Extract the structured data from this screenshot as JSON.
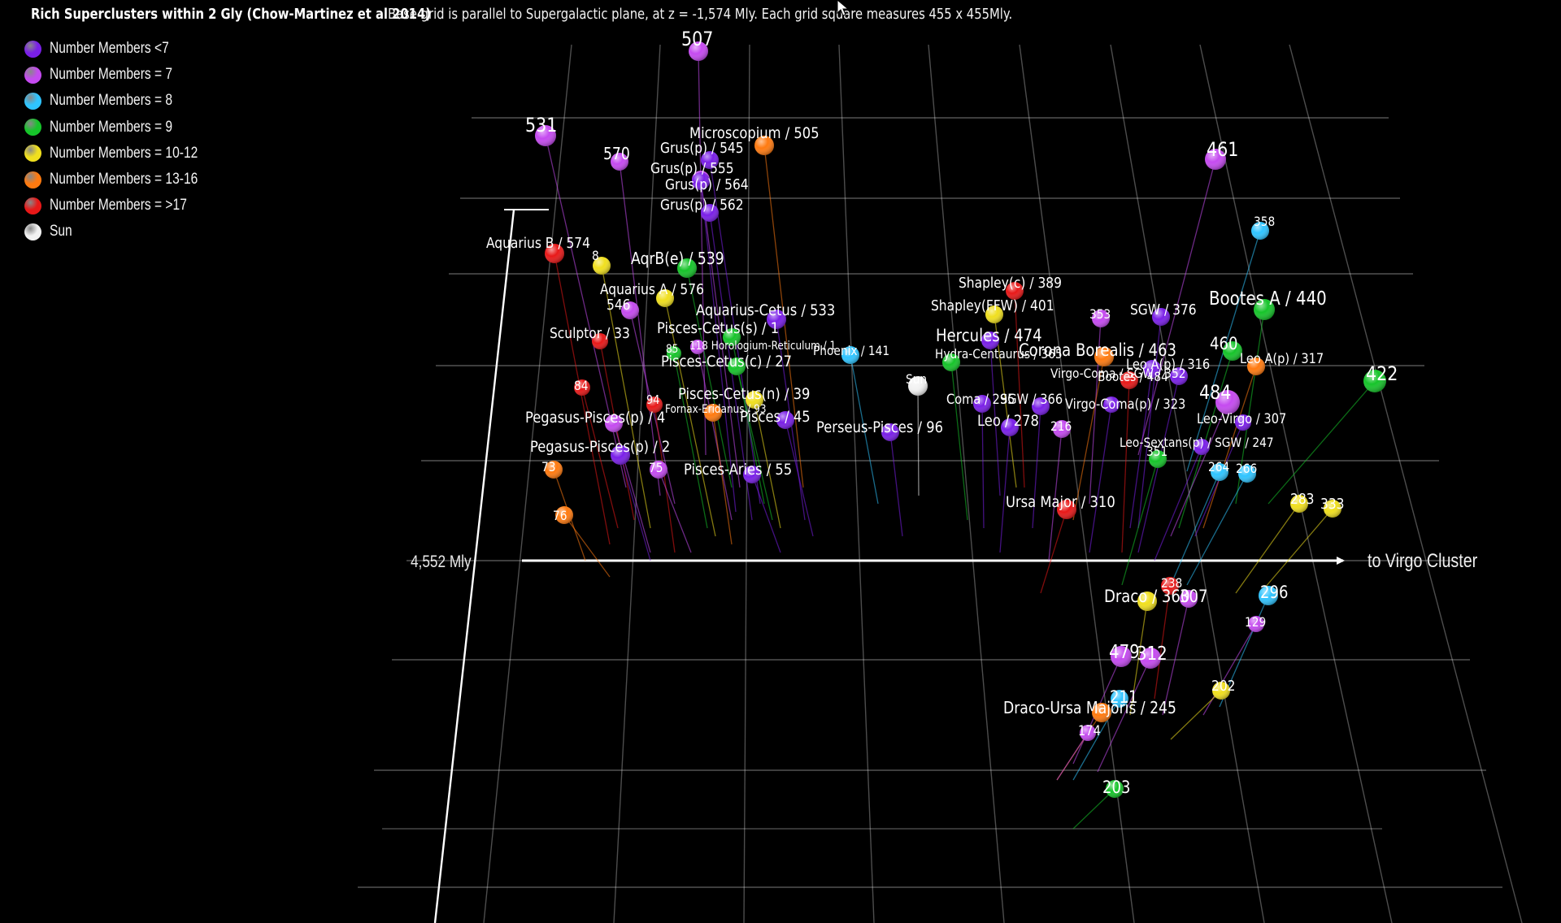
{
  "header": {
    "title": "Rich Superclusters within 2 Gly (Chow-Martinez et al 2014)",
    "description": "Base grid is parallel to Supergalactic plane, at z = -1,574 Mly. Each grid square measures 455 x 455Mly."
  },
  "legend": [
    {
      "label": "Number Members <7",
      "color": "#7a1fe8"
    },
    {
      "label": "Number Members = 7",
      "color": "#c54af0"
    },
    {
      "label": "Number Members = 8",
      "color": "#2fc4ff"
    },
    {
      "label": "Number Members = 9",
      "color": "#16c42a"
    },
    {
      "label": "Number Members = 10-12",
      "color": "#f0df1e"
    },
    {
      "label": "Number Members = 13-16",
      "color": "#ff7a10"
    },
    {
      "label": "Number Members = >17",
      "color": "#e81818"
    },
    {
      "label": "Sun",
      "color": "#f2f2f2"
    }
  ],
  "axes": {
    "distance_label": "4,552 Mly",
    "direction_label": "to Virgo Cluster"
  },
  "clusters": [
    {
      "label": "507",
      "color": "#c54af0"
    },
    {
      "label": "531",
      "color": "#c54af0"
    },
    {
      "label": "570",
      "color": "#c54af0"
    },
    {
      "label": "Microscopium / 505",
      "color": "#ff7a10"
    },
    {
      "label": "Grus(p) / 545",
      "color": "#7a1fe8"
    },
    {
      "label": "Grus(p) / 555",
      "color": "#c54af0"
    },
    {
      "label": "Grus(p) / 564",
      "color": "#7a1fe8"
    },
    {
      "label": "Grus(p) / 562",
      "color": "#7a1fe8"
    },
    {
      "label": "Aquarius B / 574",
      "color": "#e81818"
    },
    {
      "label": "8",
      "color": "#f0df1e"
    },
    {
      "label": "AqrB(e) / 539",
      "color": "#16c42a"
    },
    {
      "label": "Aquarius A / 576",
      "color": "#f0df1e"
    },
    {
      "label": "546",
      "color": "#c54af0"
    },
    {
      "label": "Aquarius-Cetus / 533",
      "color": "#7a1fe8"
    },
    {
      "label": "Sculptor / 33",
      "color": "#e81818"
    },
    {
      "label": "Pisces-Cetus(s) / 1",
      "color": "#16c42a"
    },
    {
      "label": "118 Horologium-Reticulum / 1",
      "color": "#c54af0"
    },
    {
      "label": "85",
      "color": "#16c42a"
    },
    {
      "label": "Phoenix / 141",
      "color": "#2fc4ff"
    },
    {
      "label": "Pisces-Cetus(c) / 27",
      "color": "#16c42a"
    },
    {
      "label": "Hydra-Centaurus / 365",
      "color": "#16c42a"
    },
    {
      "label": "84",
      "color": "#e81818"
    },
    {
      "label": "94",
      "color": "#e81818"
    },
    {
      "label": "Fornax-Eridanus / 93",
      "color": "#ff7a10"
    },
    {
      "label": "Pisces-Cetus(n) / 39",
      "color": "#f0df1e"
    },
    {
      "label": "Pisces / 45",
      "color": "#7a1fe8"
    },
    {
      "label": "Pegasus-Pisces(p) / 4",
      "color": "#c54af0"
    },
    {
      "label": "Pegasus-Pisces(p) / 2",
      "color": "#7a1fe8"
    },
    {
      "label": "73",
      "color": "#ff7a10"
    },
    {
      "label": "75",
      "color": "#c54af0"
    },
    {
      "label": "Pisces-Aries / 55",
      "color": "#7a1fe8"
    },
    {
      "label": "76",
      "color": "#ff7a10"
    },
    {
      "label": "Perseus-Pisces / 96",
      "color": "#7a1fe8"
    },
    {
      "label": "Sun",
      "color": "#f2f2f2"
    },
    {
      "label": "Shapley(c) / 389",
      "color": "#e81818"
    },
    {
      "label": "Shapley(FFW) / 401",
      "color": "#f0df1e"
    },
    {
      "label": "353",
      "color": "#c54af0"
    },
    {
      "label": "SGW / 376",
      "color": "#7a1fe8"
    },
    {
      "label": "Bootes A / 440",
      "color": "#16c42a"
    },
    {
      "label": "Hercules / 474",
      "color": "#7a1fe8"
    },
    {
      "label": "Corona Borealis / 463",
      "color": "#ff7a10"
    },
    {
      "label": "Leo A(p) / 316",
      "color": "#7a1fe8"
    },
    {
      "label": "460",
      "color": "#16c42a"
    },
    {
      "label": "Leo A(p) / 317",
      "color": "#ff7a10"
    },
    {
      "label": "Virgo-Coma / SGW / 352",
      "color": "#7a1fe8"
    },
    {
      "label": "Bootes / 484",
      "color": "#e81818"
    },
    {
      "label": "Coma / 295",
      "color": "#7a1fe8"
    },
    {
      "label": "SGW / 366",
      "color": "#7a1fe8"
    },
    {
      "label": "Virgo-Coma(p) / 323",
      "color": "#7a1fe8"
    },
    {
      "label": "484",
      "color": "#c54af0"
    },
    {
      "label": "Leo / 278",
      "color": "#7a1fe8"
    },
    {
      "label": "216",
      "color": "#c54af0"
    },
    {
      "label": "Leo-Virgo / 307",
      "color": "#7a1fe8"
    },
    {
      "label": "Leo-Sextans(p) / SGW / 247",
      "color": "#7a1fe8"
    },
    {
      "label": "351",
      "color": "#16c42a"
    },
    {
      "label": "264",
      "color": "#2fc4ff"
    },
    {
      "label": "266",
      "color": "#2fc4ff"
    },
    {
      "label": "461",
      "color": "#c54af0"
    },
    {
      "label": "358",
      "color": "#2fc4ff"
    },
    {
      "label": "422",
      "color": "#16c42a"
    },
    {
      "label": "Ursa Major / 310",
      "color": "#e81818"
    },
    {
      "label": "283",
      "color": "#f0df1e"
    },
    {
      "label": "333",
      "color": "#f0df1e"
    },
    {
      "label": "Draco / 360",
      "color": "#f0df1e"
    },
    {
      "label": "238",
      "color": "#e81818"
    },
    {
      "label": "307",
      "color": "#c54af0"
    },
    {
      "label": "296",
      "color": "#2fc4ff"
    },
    {
      "label": "129",
      "color": "#c54af0"
    },
    {
      "label": "479",
      "color": "#c54af0"
    },
    {
      "label": "312",
      "color": "#c54af0"
    },
    {
      "label": "211",
      "color": "#2fc4ff"
    },
    {
      "label": "Draco-Ursa Majoris / 245",
      "color": "#ff7a10"
    },
    {
      "label": "174",
      "color": "#c54af0"
    },
    {
      "label": "202",
      "color": "#f0df1e"
    },
    {
      "label": "203",
      "color": "#16c42a"
    }
  ]
}
